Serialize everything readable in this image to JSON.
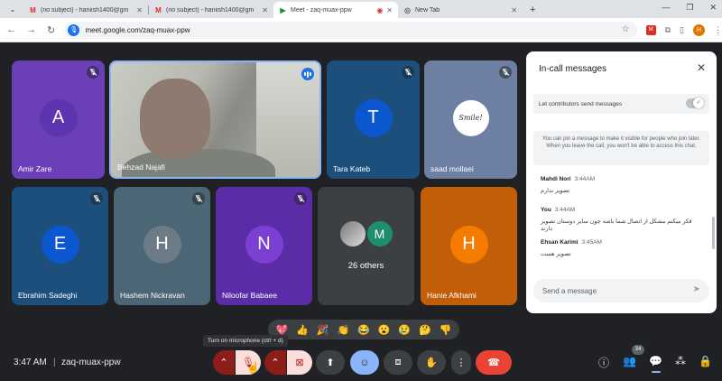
{
  "browser": {
    "tabs": [
      {
        "title": "(no subject) - haniish1400@gm",
        "favicon": "gmail-icon",
        "active": false
      },
      {
        "title": "(no subject) - haniish1400@gm",
        "favicon": "gmail-icon",
        "active": false
      },
      {
        "title": "Meet - zaq-muax-ppw",
        "favicon": "meet-icon",
        "active": true
      },
      {
        "title": "New Tab",
        "favicon": "globe-icon",
        "active": false
      }
    ],
    "url": "meet.google.com/zaq-muax-ppw",
    "profile_initial": "H"
  },
  "participants": [
    {
      "name": "Amir Zare",
      "initial": "A",
      "color": "#5e35b1",
      "bg": "#6a3fb8",
      "muted": true
    },
    {
      "name": "Behzad Najafi",
      "initial": "",
      "color": "",
      "bg": "",
      "muted": false,
      "video": true
    },
    {
      "name": "Tara Kateb",
      "initial": "T",
      "color": "#0b57d0",
      "bg": "#1c4f7c",
      "muted": true
    },
    {
      "name": "saad mollaei",
      "initial": "",
      "color": "",
      "bg": "#6d7fa3",
      "muted": true,
      "avatar_text": "Smile!"
    },
    {
      "name": "Ebrahim Sadeghi",
      "initial": "E",
      "color": "#0b57d0",
      "bg": "#1c4f7c",
      "muted": true
    },
    {
      "name": "Hashem Nickravan",
      "initial": "H",
      "color": "#6c7b86",
      "bg": "#4b6775",
      "muted": true
    },
    {
      "name": "Niloofar Babaee",
      "initial": "N",
      "color": "#7b3fd1",
      "bg": "#5b2ca8",
      "muted": true
    },
    {
      "name": "Hanie Afkhami",
      "initial": "H",
      "color": "#f57c00",
      "bg": "#c25d08",
      "muted": false
    }
  ],
  "others": {
    "label": "26 others",
    "avatar_initial": "M"
  },
  "chat": {
    "title": "In-call messages",
    "permission_label": "Let contributors send messages",
    "pin_info": "You can pin a message to make it visible for people who join later. When you leave the call, you won't be able to access this chat.",
    "messages": [
      {
        "sender": "Mahdi Nori",
        "time": "3:44AM",
        "text": "تصویر ندارم"
      },
      {
        "sender": "You",
        "time": "3:44AM",
        "text": "فکر میکنم مشکل از اتصال شما باشه چون سایر دوستان تصویر دارند"
      },
      {
        "sender": "Ehsan Karimi",
        "time": "3:45AM",
        "text": "تصویر هست"
      }
    ],
    "input_placeholder": "Send a message"
  },
  "reactions": [
    "💖",
    "👍",
    "🎉",
    "👏",
    "😂",
    "😮",
    "😢",
    "🤔",
    "👎"
  ],
  "tooltip": "Turn on microphone (ctrl + d)",
  "bottom": {
    "time": "3:47 AM",
    "divider": "|",
    "meeting_code": "zaq-muax-ppw",
    "people_count": "34"
  }
}
